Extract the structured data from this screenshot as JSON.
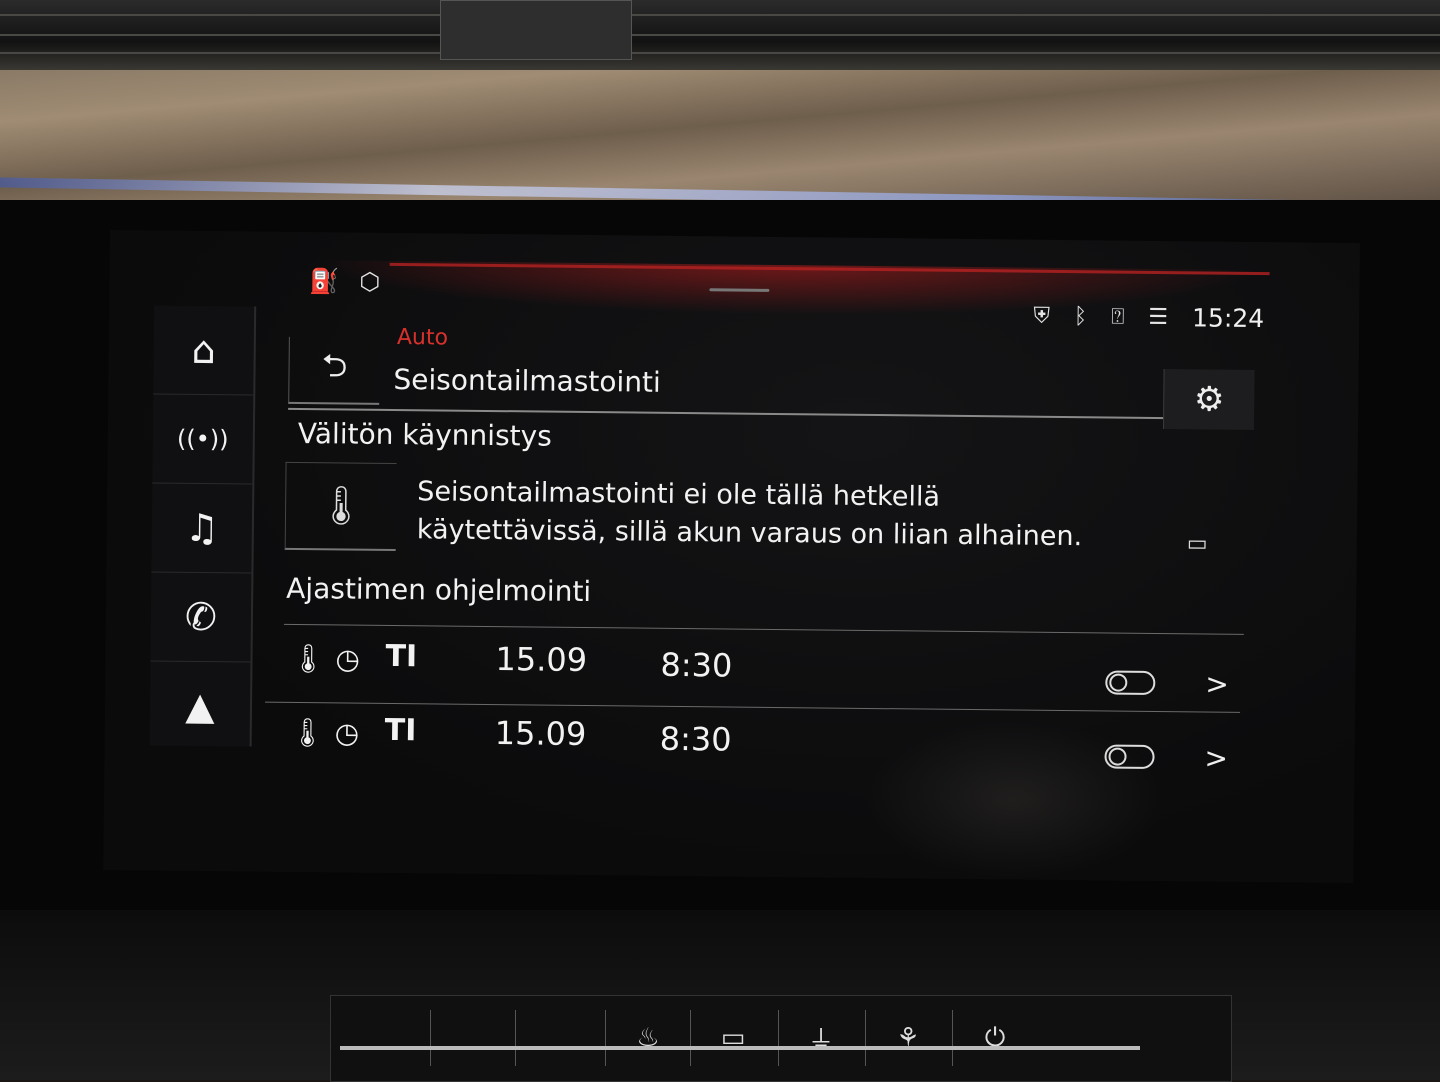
{
  "status_bar": {
    "left_icons": [
      "fuel-station-icon",
      "box-icon"
    ],
    "right_icons": [
      "shield-location-icon",
      "bluetooth-icon",
      "person-question-icon",
      "lte-signal-icon"
    ],
    "clock": "15:24"
  },
  "sidebar": {
    "items": [
      {
        "icon": "home-icon",
        "glyph": "⌂"
      },
      {
        "icon": "radio-icon",
        "glyph": "((•))"
      },
      {
        "icon": "music-icon",
        "glyph": "♫"
      },
      {
        "icon": "phone-icon",
        "glyph": "✆"
      },
      {
        "icon": "navigation-icon",
        "glyph": "▲"
      }
    ]
  },
  "header": {
    "back_glyph": "⮌",
    "breadcrumb": "Auto",
    "title": "Seisontailmastointi",
    "settings_glyph": "⚙"
  },
  "immediate_start": {
    "heading": "Välitön käynnistys",
    "thermo_glyph": "🌡",
    "notice_line1": "Seisontailmastointi ei ole tällä hetkellä",
    "notice_line2": "käytettävissä, sillä akun varaus on liian alhainen.",
    "battery_glyph": "▭"
  },
  "timers": {
    "heading": "Ajastimen ohjelmointi",
    "rows": [
      {
        "thermo": "🌡",
        "clock": "◷",
        "day": "TI",
        "date": "15.09",
        "time": "8:30",
        "enabled": false,
        "chevron": ">"
      },
      {
        "thermo": "🌡",
        "clock": "◷",
        "day": "TI",
        "date": "15.09",
        "time": "8:30",
        "enabled": false,
        "chevron": ">"
      }
    ]
  },
  "lower_controls": {
    "buttons": [
      "seat-heat-icon",
      "defrost-rear-icon",
      "plug-icon",
      "fan-off-icon",
      "power-icon"
    ]
  }
}
